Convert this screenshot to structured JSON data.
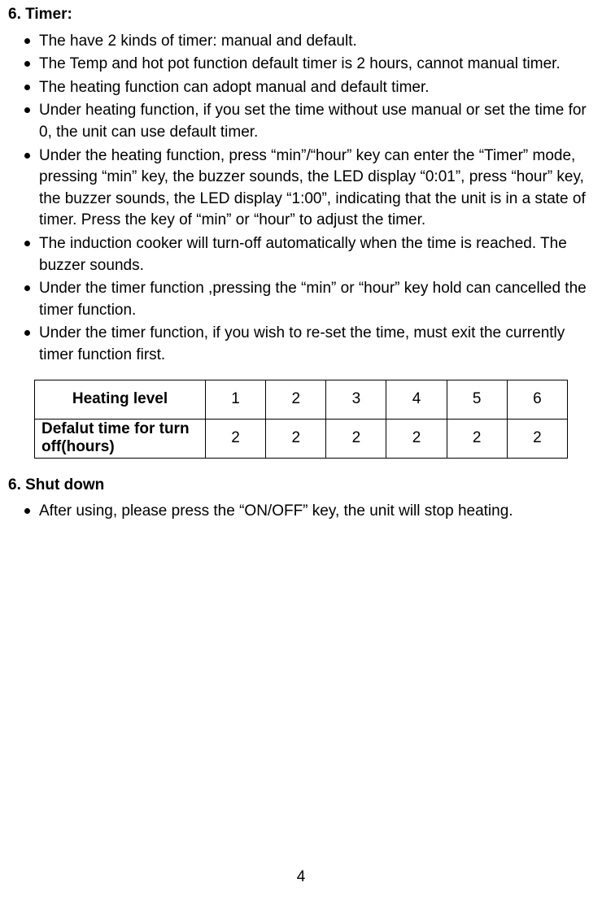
{
  "section1": {
    "heading": "6. Timer:",
    "bullets": [
      "The have 2 kinds of timer: manual and default.",
      "The Temp and hot pot function default timer is 2 hours, cannot manual timer.",
      "The heating function can adopt manual and default timer.",
      "Under heating function, if you set the time without use manual or set the time for 0, the unit can use default timer.",
      "Under the heating function, press “min”/“hour” key can enter the “Timer” mode, pressing “min” key, the buzzer sounds, the LED display “0:01”, press “hour” key, the buzzer sounds, the LED display “1:00”, indicating that the unit is in a state of timer. Press the key of “min” or “hour” to adjust the timer.",
      "The induction cooker will turn-off automatically when the time is reached. The buzzer sounds.",
      "Under the timer function ,pressing the “min” or “hour” key hold can cancelled the timer function.",
      "Under the timer function, if you wish to re-set the time, must exit the currently timer function first."
    ]
  },
  "table": {
    "row1_label": "Heating level",
    "row1_values": [
      "1",
      "2",
      "3",
      "4",
      "5",
      "6"
    ],
    "row2_label": "Defalut time for turn off(hours)",
    "row2_values": [
      "2",
      "2",
      "2",
      "2",
      "2",
      "2"
    ]
  },
  "section2": {
    "heading": "6. Shut down",
    "bullets": [
      "After using, please press the “ON/OFF” key, the unit will stop heating."
    ]
  },
  "page_number": "4"
}
